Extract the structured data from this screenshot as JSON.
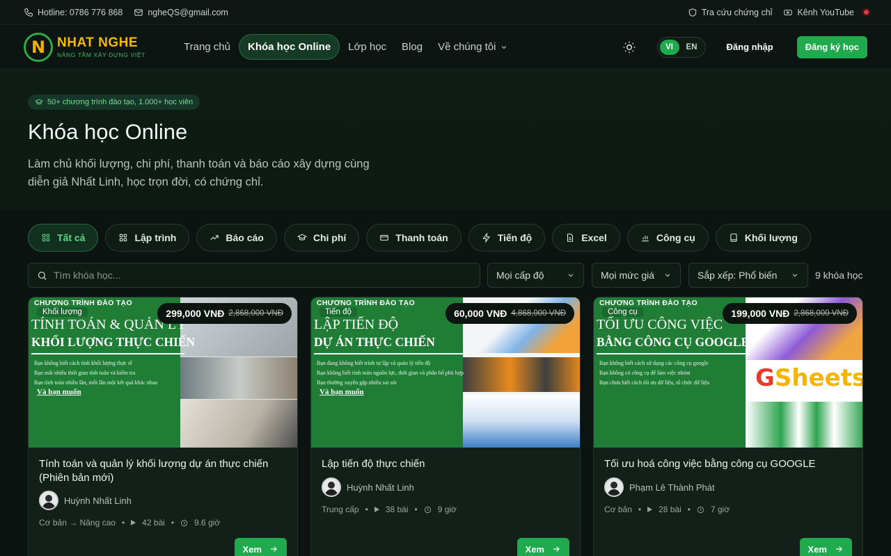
{
  "topbar": {
    "hotline": "Hotline: 0786 776 868",
    "email": "ngheQS@gmail.com",
    "lookup": "Tra cứu chứng chỉ",
    "youtube": "Kênh YouTube"
  },
  "brand": {
    "name": "NHAT NGHE",
    "slogan": "NÂNG TẦM XÂY DỰNG VIỆT"
  },
  "nav": {
    "items": [
      "Trang chủ",
      "Khóa học Online",
      "Lớp học",
      "Blog",
      "Về chúng tôi"
    ],
    "lang": [
      "VI",
      "EN"
    ],
    "login": "Đăng nhập",
    "signup": "Đăng ký học"
  },
  "hero": {
    "badge": "50+ chương trình đào tạo, 1.000+ học viên",
    "title": "Khóa học Online",
    "desc": "Làm chủ khối lượng, chi phí, thanh toán và báo cáo xây dựng cùng diễn giả Nhất Linh, học trọn đời, có chứng chỉ."
  },
  "filters": [
    "Tất cả",
    "Lập trình",
    "Báo cáo",
    "Chi phí",
    "Thanh toán",
    "Tiến độ",
    "Excel",
    "Công cụ",
    "Khối lượng"
  ],
  "search": {
    "placeholder": "Tìm khóa học...",
    "level": "Mọi cấp độ",
    "price": "Mọi mức giá",
    "sort": "Sắp xếp: Phổ biến",
    "count": "9 khóa học"
  },
  "common": {
    "program": "CHƯƠNG TRÌNH ĐÀO TẠO",
    "view": "Xem",
    "want": "Và bạn muốn"
  },
  "courses": [
    {
      "category": "Khối lượng",
      "price": "299,000 VNĐ",
      "old_price": "2,868,000 VNĐ",
      "banner_line1": "TÍNH TOÁN & QUẢN LÝ",
      "banner_line2": "KHỐI LƯỢNG THỰC CHIẾN",
      "bullets": [
        "Bạn không biết cách tính khối lượng thực tế",
        "Bạn mất nhiều thời gian tính toán và kiểm tra",
        "Bạn tính toán nhiều lần, mỗi lần một kết quả khác nhau"
      ],
      "title": "Tính toán và quản lý khối lượng dự án thực chiến (Phiên bản mới)",
      "author": "Huỳnh Nhất Linh",
      "level": "Cơ bản → Nâng cao",
      "lessons": "42 bài",
      "hours": "9.6 giờ"
    },
    {
      "category": "Tiến độ",
      "price": "60,000 VNĐ",
      "old_price": "4,868,000 VNĐ",
      "banner_line1": "LẬP TIẾN ĐỘ",
      "banner_line2": "DỰ ÁN THỰC CHIẾN",
      "bullets": [
        "Bạn đang không biết trình tự lập và quản lý tiến độ",
        "Bạn không biết tính toán nguồn lực, thời gian và phân bổ phù hợp",
        "Bạn thường xuyên gặp nhiều sai sót"
      ],
      "title": "Lập tiến độ thực chiến",
      "author": "Huỳnh Nhất Linh",
      "level": "Trung cấp",
      "lessons": "38 bài",
      "hours": "9 giờ"
    },
    {
      "category": "Công cụ",
      "price": "199,000 VNĐ",
      "old_price": "2,868,000 VNĐ",
      "banner_line1": "TỐI ƯU CÔNG VIỆC",
      "banner_line2": "BẰNG CÔNG CỤ GOOGLE",
      "bullets": [
        "Bạn không biết cách sử dụng các công cụ google",
        "Bạn không có công cụ để làm việc nhóm",
        "Bạn chưa biết cách tối ưu dữ liệu, tổ chức dữ liệu"
      ],
      "title": "Tối ưu hoá công việc bằng công cụ GOOGLE",
      "author": "Phạm Lê Thành Phát",
      "level": "Cơ bản",
      "lessons": "28 bài",
      "hours": "7 giờ"
    }
  ],
  "colors": {
    "accent": "#1faa4d",
    "brand_yellow": "#f5b800",
    "bg": "#0b1410"
  },
  "icons": [
    "phone-icon",
    "mail-icon",
    "shield-icon",
    "youtube-icon",
    "sun-icon",
    "search-icon",
    "chevron-down-icon",
    "arrow-right-icon",
    "clock-icon",
    "play-icon"
  ]
}
